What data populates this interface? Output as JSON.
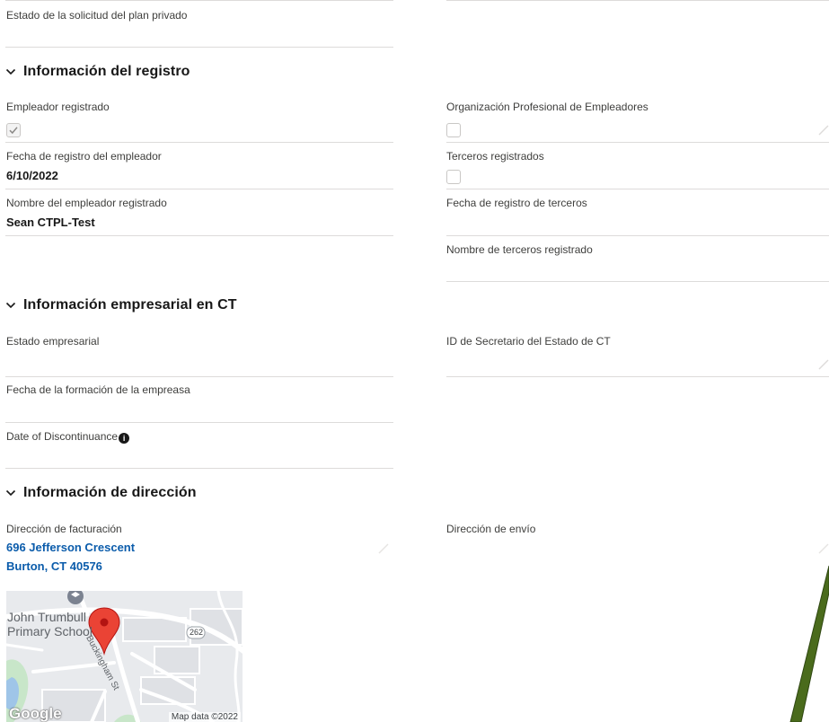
{
  "top": {
    "private_plan_status_label": "Estado de la solicitud del plan privado"
  },
  "registration": {
    "title": "Información del registro",
    "employer_registered_label": "Empleador registrado",
    "employer_registered_checked": true,
    "peo_label": "Organización Profesional de Empleadores",
    "peo_checked": false,
    "employer_registration_date_label": "Fecha de registro del empleador",
    "employer_registration_date_value": "6/10/2022",
    "third_parties_registered_label": "Terceros registrados",
    "third_parties_registered_checked": false,
    "registered_employer_name_label": "Nombre del empleador registrado",
    "registered_employer_name_value": "Sean CTPL-Test",
    "third_party_registration_date_label": "Fecha de registro de terceros",
    "registered_third_party_name_label": "Nombre de terceros registrado"
  },
  "business": {
    "title": "Información empresarial en CT",
    "business_status_label": "Estado empresarial",
    "secretary_id_label": "ID de Secretario del Estado de CT",
    "formation_date_label": "Fecha de la formación de la empreasa",
    "discontinuance_label": "Date of Discontinuance",
    "info_icon_glyph": "i"
  },
  "address": {
    "title": "Información de dirección",
    "billing_label": "Dirección de facturación",
    "billing_line1": "696 Jefferson Crescent",
    "billing_line2": "Burton, CT 40576",
    "shipping_label": "Dirección de envío"
  },
  "map": {
    "place_label_line1": "John Trumbull",
    "place_label_line2": "Primary School",
    "street_label": "Buckingham St",
    "route_badge": "262",
    "google_logo": "Google",
    "attribution": "Map data ©2022"
  },
  "colors": {
    "link": "#0b5cab",
    "divider": "#dddbda",
    "pin": "#ea4335",
    "arrow": "#4a6b1c"
  },
  "icons": [
    "chevron-down-icon",
    "pencil-icon",
    "info-icon",
    "map-pin-icon",
    "check-icon"
  ]
}
